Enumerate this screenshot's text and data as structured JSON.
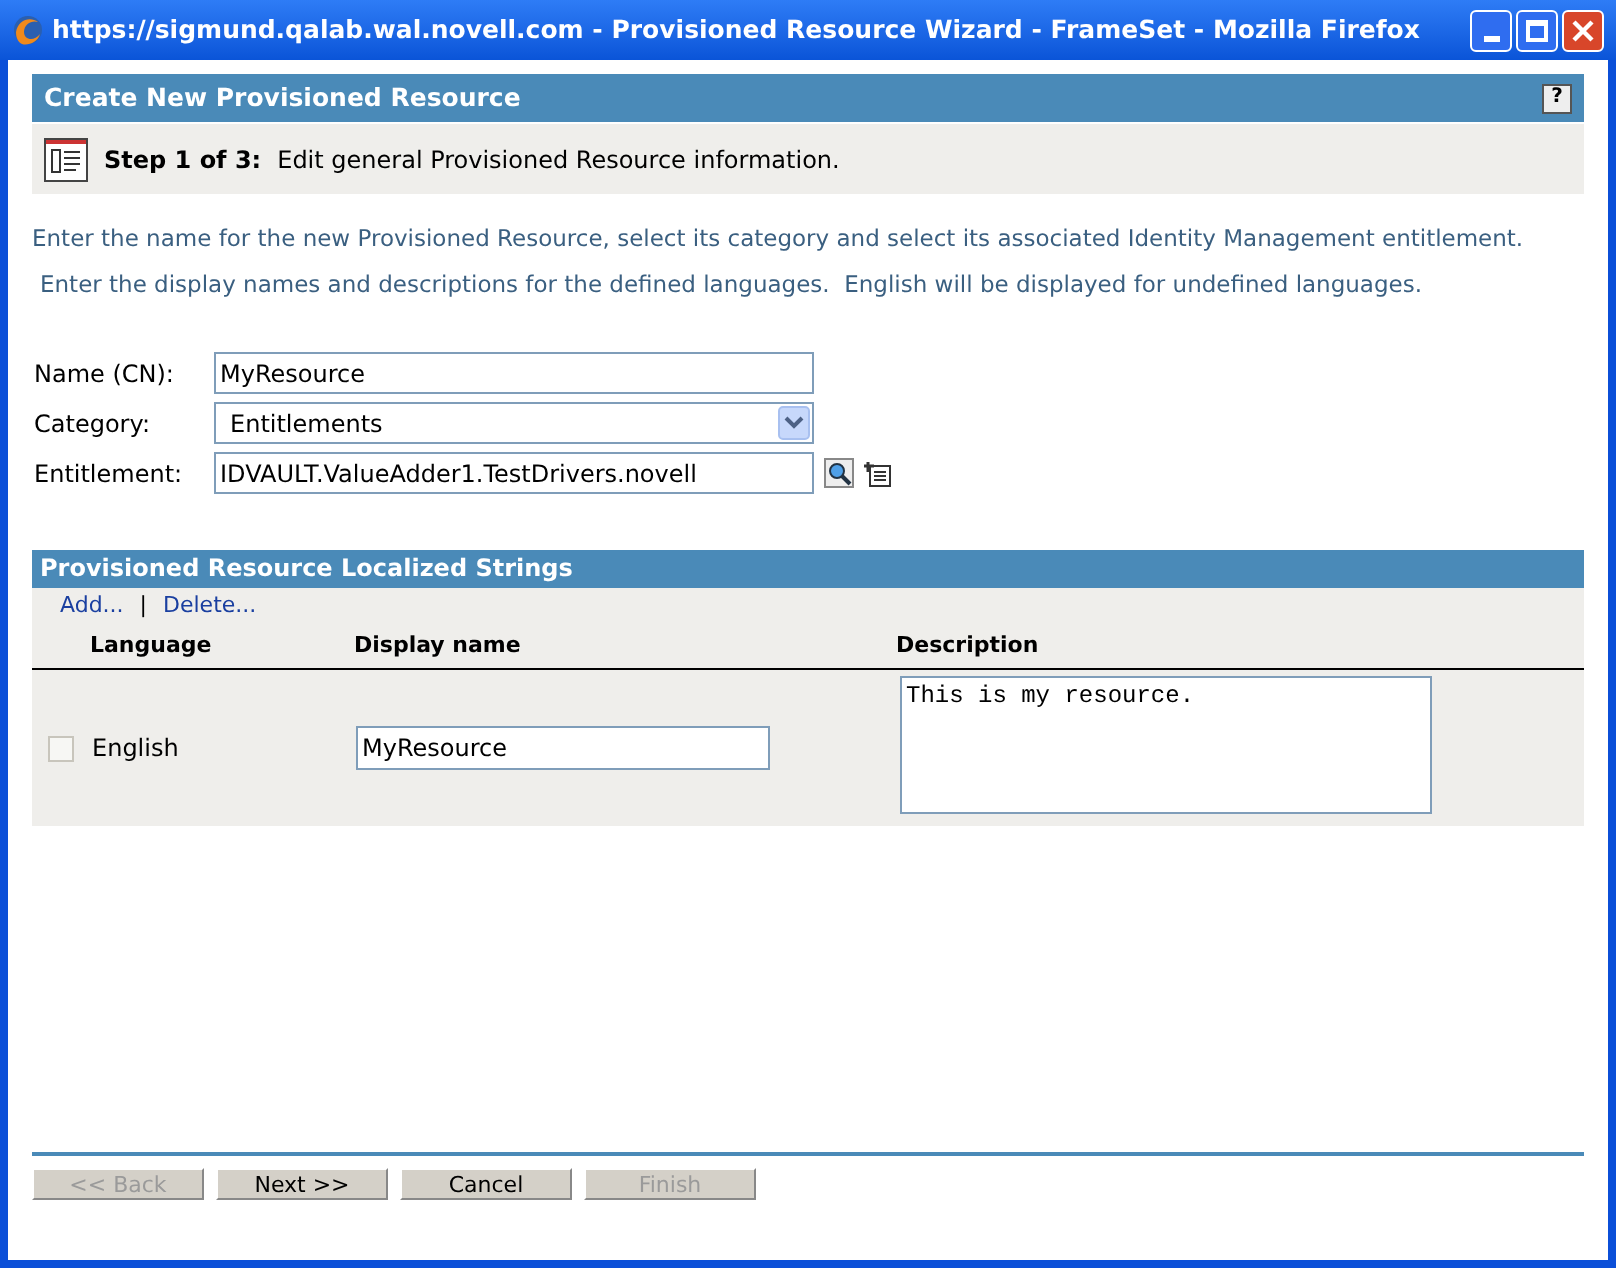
{
  "window": {
    "title": "https://sigmund.qalab.wal.novell.com - Provisioned Resource Wizard - FrameSet - Mozilla Firefox"
  },
  "header": {
    "title": "Create New Provisioned Resource",
    "help": "?"
  },
  "step": {
    "label": "Step 1 of 3:",
    "text": "Edit general Provisioned Resource information."
  },
  "instructions": [
    "Enter the name for the new Provisioned Resource, select its category and select its associated Identity Management entitlement.",
    "Enter the display names and descriptions for the defined languages.  English will be displayed for undefined languages."
  ],
  "form": [
    {
      "kind": "text",
      "label": "Name (CN):",
      "value": "MyResource"
    },
    {
      "kind": "select",
      "label": "Category:",
      "value": "Entitlements"
    },
    {
      "kind": "lookup",
      "label": "Entitlement:",
      "value": "IDVAULT.ValueAdder1.TestDrivers.novell"
    }
  ],
  "strings": {
    "title": "Provisioned Resource Localized Strings",
    "actions": [
      "Add...",
      "Delete..."
    ],
    "separator": "|",
    "columns": [
      "Language",
      "Display name",
      "Description"
    ],
    "rows": [
      {
        "checked": false,
        "language": "English",
        "display_name": "MyResource",
        "description": "This is my resource."
      }
    ]
  },
  "buttons": [
    {
      "label": "<< Back",
      "disabled": true
    },
    {
      "label": "Next >>",
      "disabled": false
    },
    {
      "label": "Cancel",
      "disabled": false
    },
    {
      "label": "Finish",
      "disabled": true
    }
  ]
}
